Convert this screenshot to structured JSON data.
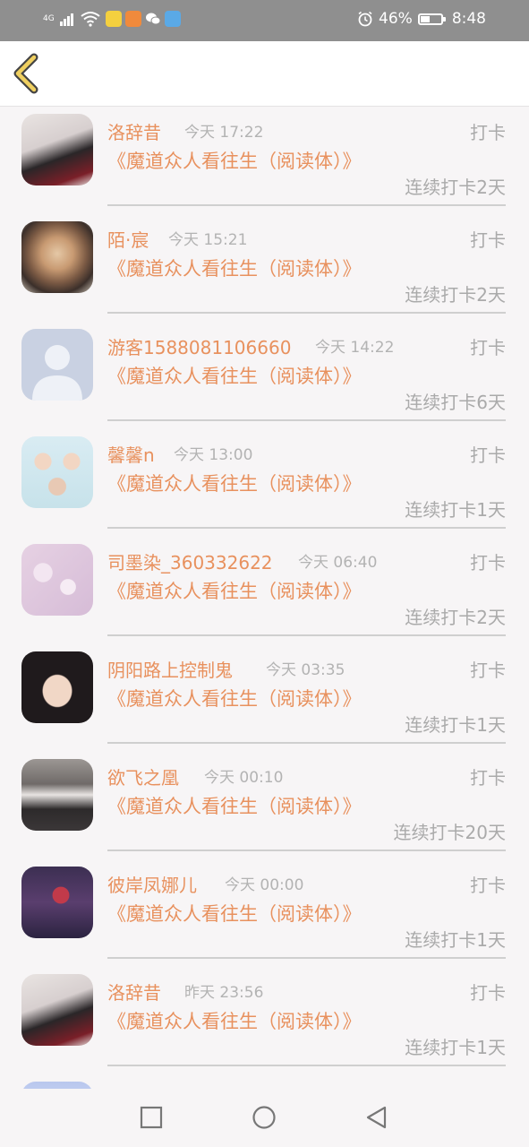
{
  "status_bar": {
    "network": "4G",
    "battery": "46%",
    "battery_level": 0.46,
    "time": "8:48",
    "icons": [
      "signal-icon",
      "wifi-icon",
      "app-notification-icon",
      "video-app-icon",
      "wechat-icon",
      "browser-app-icon",
      "alarm-icon",
      "battery-icon"
    ]
  },
  "nav": {
    "back_icon": "chevron-left-icon"
  },
  "list": {
    "items": [
      {
        "name": "洛辞昔",
        "time": "今天 17:22",
        "action": "打卡",
        "book": "《魔道众人看往生（阅读体）》",
        "streak": "连续打卡2天"
      },
      {
        "name": "陌·宸",
        "time": "今天 15:21",
        "action": "打卡",
        "book": "《魔道众人看往生（阅读体）》",
        "streak": "连续打卡2天"
      },
      {
        "name": "游客1588081106660",
        "time": "今天 14:22",
        "action": "打卡",
        "book": "《魔道众人看往生（阅读体）》",
        "streak": "连续打卡6天"
      },
      {
        "name": "馨馨n",
        "time": "今天 13:00",
        "action": "打卡",
        "book": "《魔道众人看往生（阅读体）》",
        "streak": "连续打卡1天"
      },
      {
        "name": "司墨染_360332622",
        "time": "今天 06:40",
        "action": "打卡",
        "book": "《魔道众人看往生（阅读体）》",
        "streak": "连续打卡2天"
      },
      {
        "name": "阴阳路上控制鬼",
        "time": "今天 03:35",
        "action": "打卡",
        "book": "《魔道众人看往生（阅读体）》",
        "streak": "连续打卡1天"
      },
      {
        "name": "欲飞之凰",
        "time": "今天 00:10",
        "action": "打卡",
        "book": "《魔道众人看往生（阅读体）》",
        "streak": "连续打卡20天"
      },
      {
        "name": "彼岸凤娜儿",
        "time": "今天 00:00",
        "action": "打卡",
        "book": "《魔道众人看往生（阅读体）》",
        "streak": "连续打卡1天"
      },
      {
        "name": "洛辞昔",
        "time": "昨天 23:56",
        "action": "打卡",
        "book": "《魔道众人看往生（阅读体）》",
        "streak": "连续打卡1天"
      }
    ]
  },
  "bottom_nav": {
    "icons": [
      "recent-apps-icon",
      "home-icon",
      "back-triangle-icon"
    ]
  },
  "colors": {
    "accent": "#e8915e",
    "muted": "#aaaaaa",
    "background": "#f7f5f6",
    "status_bar": "#8f8f8f"
  }
}
